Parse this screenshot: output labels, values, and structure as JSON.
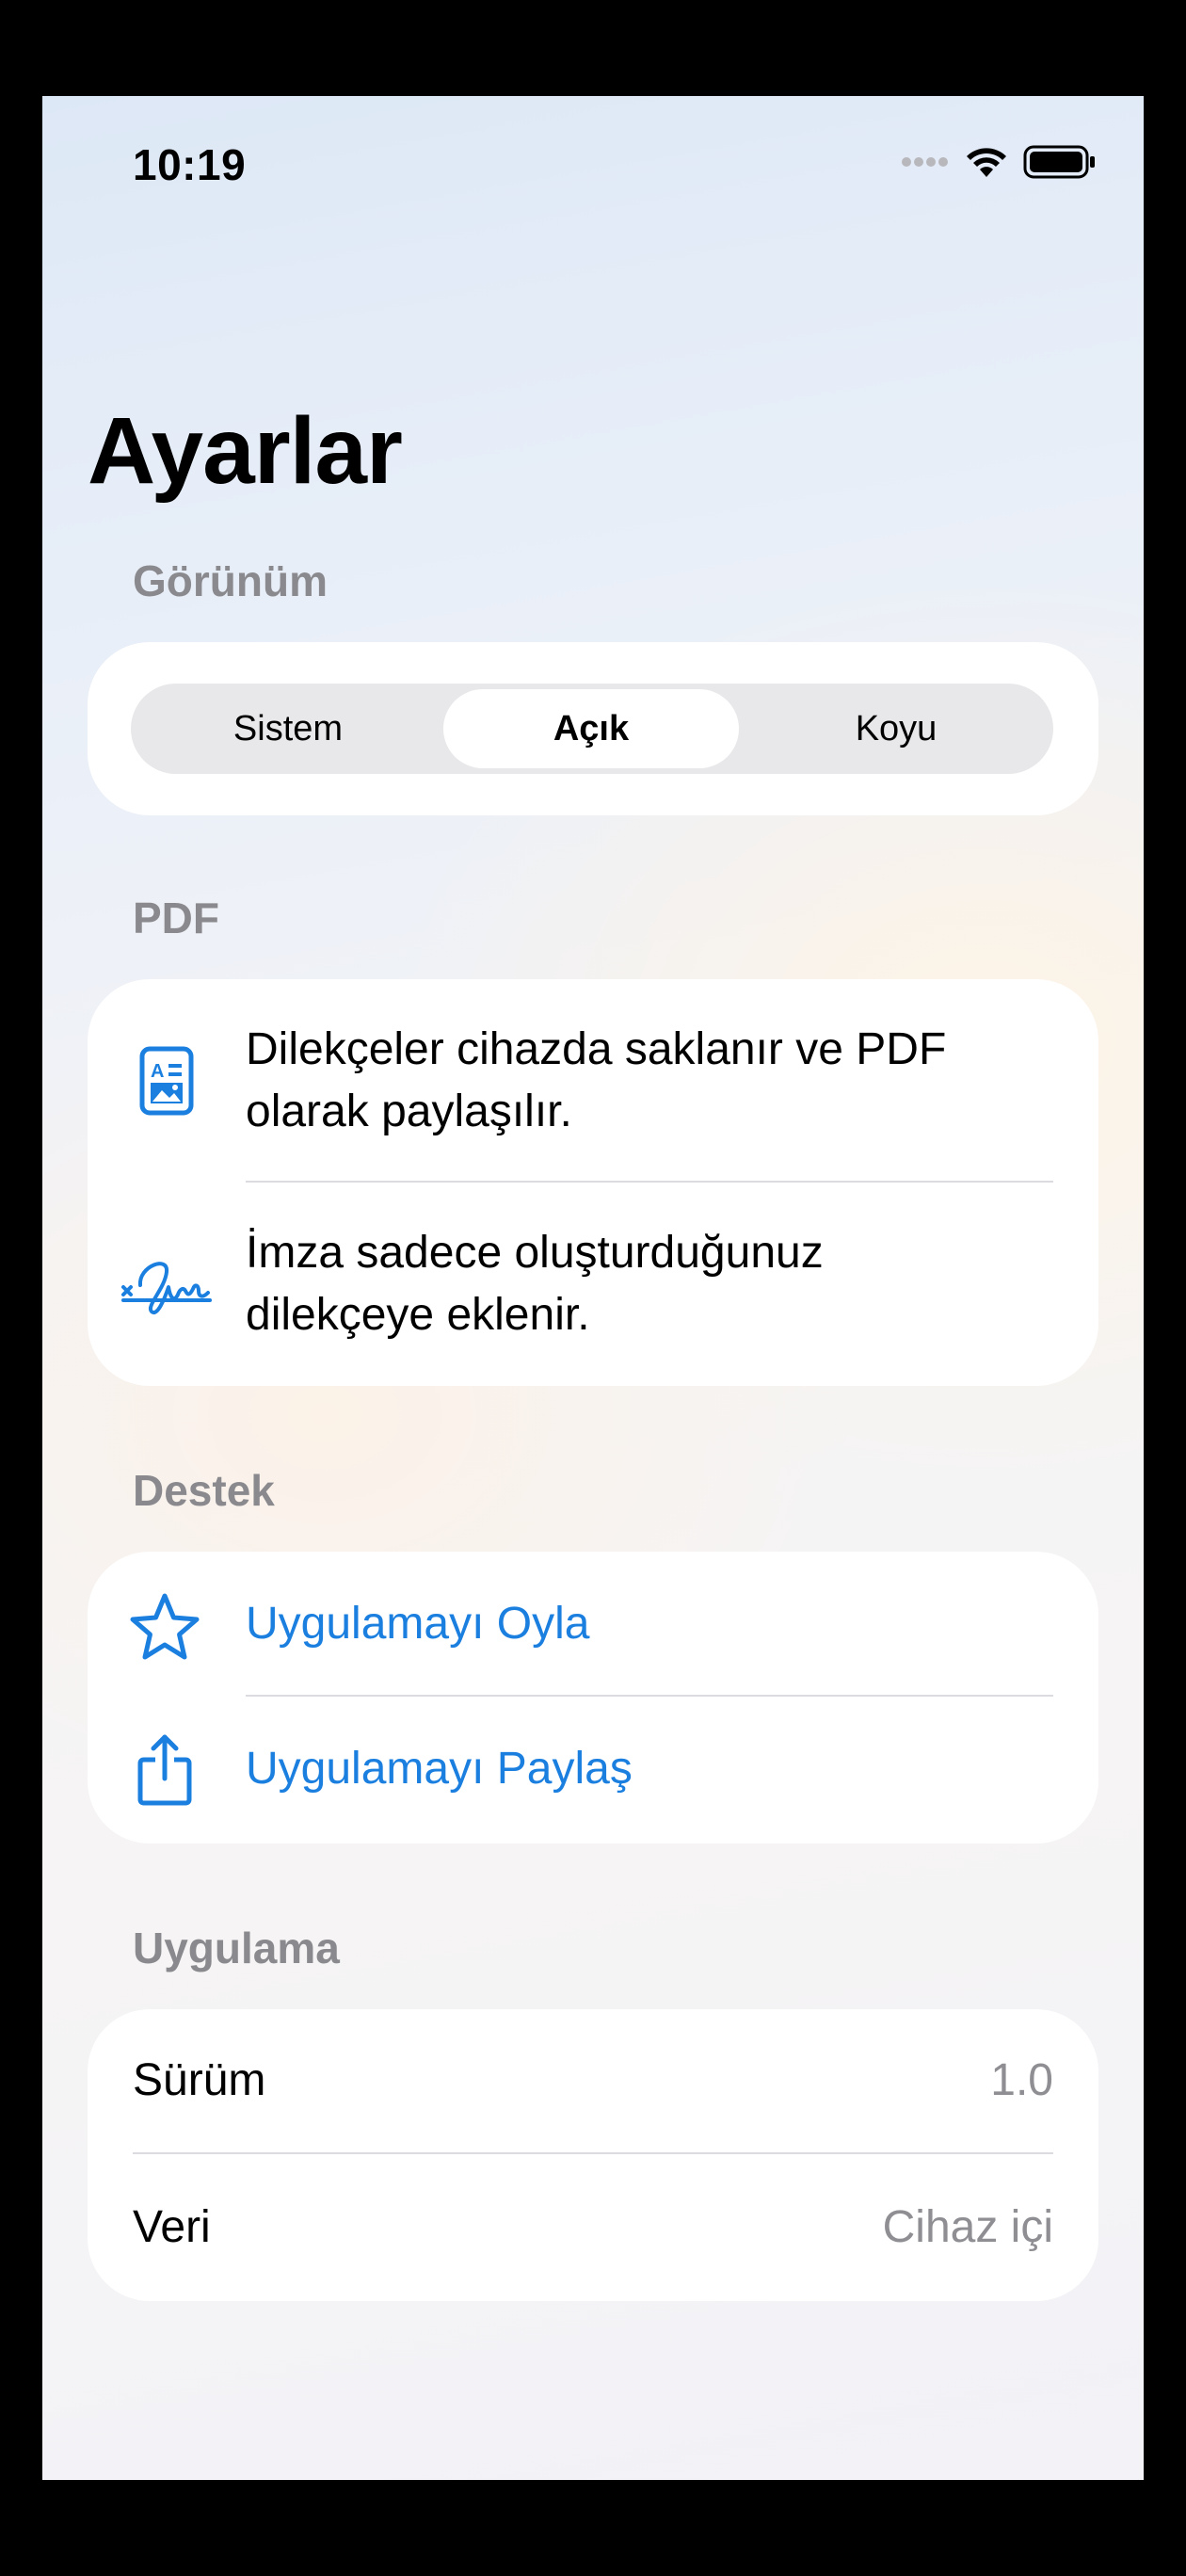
{
  "status_bar": {
    "time": "10:19"
  },
  "page": {
    "title": "Ayarlar"
  },
  "appearance": {
    "header": "Görünüm",
    "options": [
      "Sistem",
      "Açık",
      "Koyu"
    ],
    "selected": "Açık"
  },
  "pdf": {
    "header": "PDF",
    "rows": [
      {
        "icon": "document-icon",
        "text_line1": "Dilekçeler cihazda saklanır ve PDF",
        "text_line2": "olarak paylaşılır."
      },
      {
        "icon": "signature-icon",
        "text_line1": "İmza sadece oluşturduğunuz",
        "text_line2": "dilekçeye eklenir."
      }
    ]
  },
  "support": {
    "header": "Destek",
    "rows": [
      {
        "icon": "star-icon",
        "label": "Uygulamayı Oyla"
      },
      {
        "icon": "share-icon",
        "label": "Uygulamayı Paylaş"
      }
    ]
  },
  "app": {
    "header": "Uygulama",
    "rows": [
      {
        "label": "Sürüm",
        "value": "1.0"
      },
      {
        "label": "Veri",
        "value": "Cihaz içi"
      }
    ]
  },
  "colors": {
    "accent": "#1b7fe0",
    "secondary_text": "#8e8e93"
  }
}
